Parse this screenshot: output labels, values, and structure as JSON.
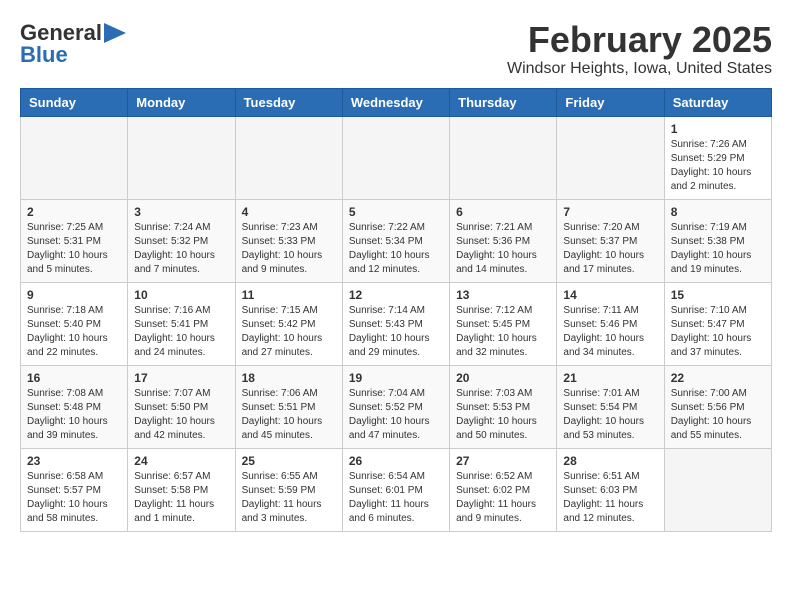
{
  "header": {
    "logo_line1": "General",
    "logo_line2": "Blue",
    "month": "February 2025",
    "location": "Windsor Heights, Iowa, United States"
  },
  "days_of_week": [
    "Sunday",
    "Monday",
    "Tuesday",
    "Wednesday",
    "Thursday",
    "Friday",
    "Saturday"
  ],
  "weeks": [
    [
      {
        "day": "",
        "text": ""
      },
      {
        "day": "",
        "text": ""
      },
      {
        "day": "",
        "text": ""
      },
      {
        "day": "",
        "text": ""
      },
      {
        "day": "",
        "text": ""
      },
      {
        "day": "",
        "text": ""
      },
      {
        "day": "1",
        "text": "Sunrise: 7:26 AM\nSunset: 5:29 PM\nDaylight: 10 hours and 2 minutes."
      }
    ],
    [
      {
        "day": "2",
        "text": "Sunrise: 7:25 AM\nSunset: 5:31 PM\nDaylight: 10 hours and 5 minutes."
      },
      {
        "day": "3",
        "text": "Sunrise: 7:24 AM\nSunset: 5:32 PM\nDaylight: 10 hours and 7 minutes."
      },
      {
        "day": "4",
        "text": "Sunrise: 7:23 AM\nSunset: 5:33 PM\nDaylight: 10 hours and 9 minutes."
      },
      {
        "day": "5",
        "text": "Sunrise: 7:22 AM\nSunset: 5:34 PM\nDaylight: 10 hours and 12 minutes."
      },
      {
        "day": "6",
        "text": "Sunrise: 7:21 AM\nSunset: 5:36 PM\nDaylight: 10 hours and 14 minutes."
      },
      {
        "day": "7",
        "text": "Sunrise: 7:20 AM\nSunset: 5:37 PM\nDaylight: 10 hours and 17 minutes."
      },
      {
        "day": "8",
        "text": "Sunrise: 7:19 AM\nSunset: 5:38 PM\nDaylight: 10 hours and 19 minutes."
      }
    ],
    [
      {
        "day": "9",
        "text": "Sunrise: 7:18 AM\nSunset: 5:40 PM\nDaylight: 10 hours and 22 minutes."
      },
      {
        "day": "10",
        "text": "Sunrise: 7:16 AM\nSunset: 5:41 PM\nDaylight: 10 hours and 24 minutes."
      },
      {
        "day": "11",
        "text": "Sunrise: 7:15 AM\nSunset: 5:42 PM\nDaylight: 10 hours and 27 minutes."
      },
      {
        "day": "12",
        "text": "Sunrise: 7:14 AM\nSunset: 5:43 PM\nDaylight: 10 hours and 29 minutes."
      },
      {
        "day": "13",
        "text": "Sunrise: 7:12 AM\nSunset: 5:45 PM\nDaylight: 10 hours and 32 minutes."
      },
      {
        "day": "14",
        "text": "Sunrise: 7:11 AM\nSunset: 5:46 PM\nDaylight: 10 hours and 34 minutes."
      },
      {
        "day": "15",
        "text": "Sunrise: 7:10 AM\nSunset: 5:47 PM\nDaylight: 10 hours and 37 minutes."
      }
    ],
    [
      {
        "day": "16",
        "text": "Sunrise: 7:08 AM\nSunset: 5:48 PM\nDaylight: 10 hours and 39 minutes."
      },
      {
        "day": "17",
        "text": "Sunrise: 7:07 AM\nSunset: 5:50 PM\nDaylight: 10 hours and 42 minutes."
      },
      {
        "day": "18",
        "text": "Sunrise: 7:06 AM\nSunset: 5:51 PM\nDaylight: 10 hours and 45 minutes."
      },
      {
        "day": "19",
        "text": "Sunrise: 7:04 AM\nSunset: 5:52 PM\nDaylight: 10 hours and 47 minutes."
      },
      {
        "day": "20",
        "text": "Sunrise: 7:03 AM\nSunset: 5:53 PM\nDaylight: 10 hours and 50 minutes."
      },
      {
        "day": "21",
        "text": "Sunrise: 7:01 AM\nSunset: 5:54 PM\nDaylight: 10 hours and 53 minutes."
      },
      {
        "day": "22",
        "text": "Sunrise: 7:00 AM\nSunset: 5:56 PM\nDaylight: 10 hours and 55 minutes."
      }
    ],
    [
      {
        "day": "23",
        "text": "Sunrise: 6:58 AM\nSunset: 5:57 PM\nDaylight: 10 hours and 58 minutes."
      },
      {
        "day": "24",
        "text": "Sunrise: 6:57 AM\nSunset: 5:58 PM\nDaylight: 11 hours and 1 minute."
      },
      {
        "day": "25",
        "text": "Sunrise: 6:55 AM\nSunset: 5:59 PM\nDaylight: 11 hours and 3 minutes."
      },
      {
        "day": "26",
        "text": "Sunrise: 6:54 AM\nSunset: 6:01 PM\nDaylight: 11 hours and 6 minutes."
      },
      {
        "day": "27",
        "text": "Sunrise: 6:52 AM\nSunset: 6:02 PM\nDaylight: 11 hours and 9 minutes."
      },
      {
        "day": "28",
        "text": "Sunrise: 6:51 AM\nSunset: 6:03 PM\nDaylight: 11 hours and 12 minutes."
      },
      {
        "day": "",
        "text": ""
      }
    ]
  ]
}
